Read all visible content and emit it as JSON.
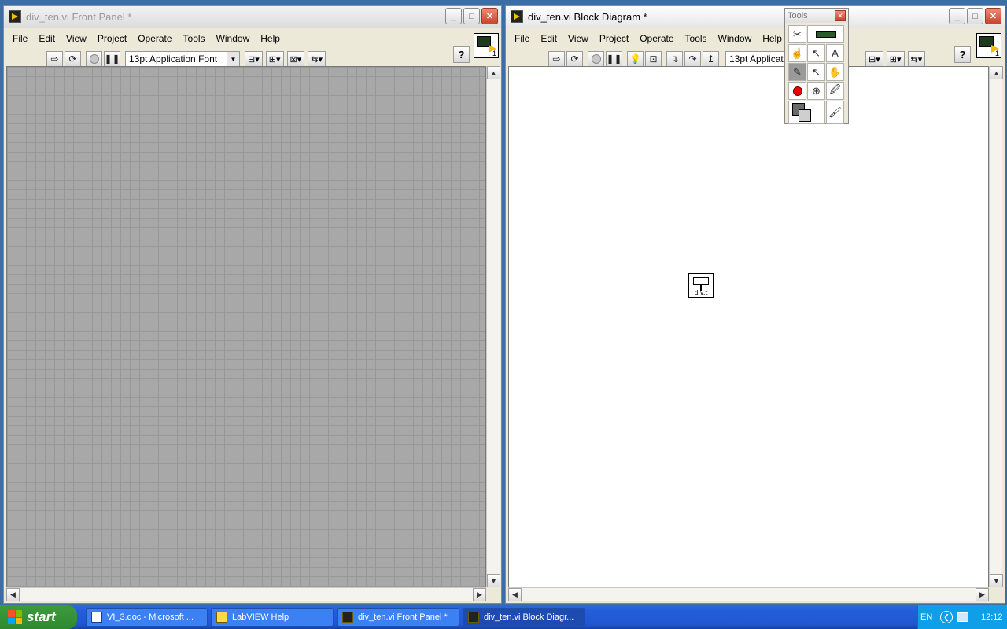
{
  "front_panel": {
    "title": "div_ten.vi Front Panel *",
    "menu": [
      "File",
      "Edit",
      "View",
      "Project",
      "Operate",
      "Tools",
      "Window",
      "Help"
    ],
    "font": "13pt Application Font",
    "help": "?"
  },
  "block_diagram": {
    "title": "div_ten.vi Block Diagram *",
    "menu": [
      "File",
      "Edit",
      "View",
      "Project",
      "Operate",
      "Tools",
      "Window",
      "Help"
    ],
    "font": "13pt Application Font",
    "help": "?",
    "subvi_label": "div.t"
  },
  "tools_palette": {
    "title": "Tools"
  },
  "taskbar": {
    "start": "start",
    "tasks": [
      "VI_3.doc - Microsoft ...",
      "LabVIEW Help",
      "div_ten.vi Front Panel *",
      "div_ten.vi Block Diagr..."
    ],
    "language": "EN",
    "clock": "12:12"
  },
  "vi_icon_number": "1"
}
